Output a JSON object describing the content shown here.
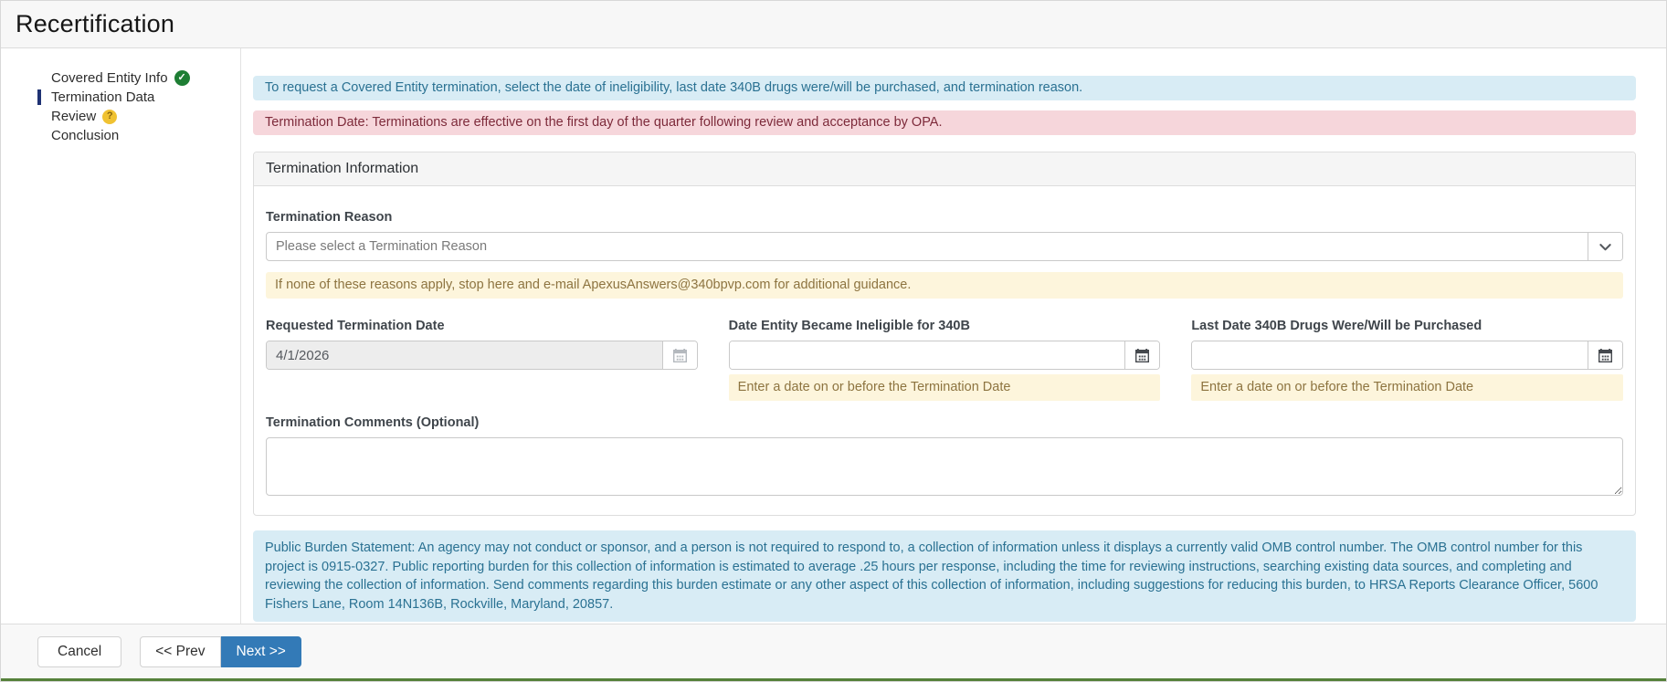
{
  "page": {
    "title": "Recertification"
  },
  "sidebar": {
    "items": [
      {
        "label": "Covered Entity Info",
        "status_icon": "check-circle",
        "active": false
      },
      {
        "label": "Termination Data",
        "status_icon": null,
        "active": true
      },
      {
        "label": "Review",
        "status_icon": "question-circle",
        "active": false
      },
      {
        "label": "Conclusion",
        "status_icon": null,
        "active": false
      }
    ]
  },
  "icons": {
    "check": "✓",
    "question": "?"
  },
  "alerts": {
    "info": "To request a Covered Entity termination, select the date of ineligibility, last date 340B drugs were/will be purchased, and termination reason.",
    "danger": "Termination Date: Terminations are effective on the first day of the quarter following review and acceptance by OPA."
  },
  "panel": {
    "title": "Termination Information",
    "reason": {
      "label": "Termination Reason",
      "placeholder": "Please select a Termination Reason"
    },
    "reason_note": "If none of these reasons apply, stop here and e-mail ApexusAnswers@340bpvp.com for additional guidance.",
    "dates": [
      {
        "label": "Requested Termination Date",
        "value": "4/1/2026",
        "disabled": true,
        "note": ""
      },
      {
        "label": "Date Entity Became Ineligible for 340B",
        "value": "",
        "disabled": false,
        "note": "Enter a date on or before the Termination Date"
      },
      {
        "label": "Last Date 340B Drugs Were/Will be Purchased",
        "value": "",
        "disabled": false,
        "note": "Enter a date on or before the Termination Date"
      }
    ],
    "comments": {
      "label": "Termination Comments (Optional)",
      "value": ""
    }
  },
  "burden_statement": "Public Burden Statement: An agency may not conduct or sponsor, and a person is not required to respond to, a collection of information unless it displays a currently valid OMB control number. The OMB control number for this project is 0915-0327. Public reporting burden for this collection of information is estimated to average .25 hours per response, including the time for reviewing instructions, searching existing data sources, and completing and reviewing the collection of information. Send comments regarding this burden estimate or any other aspect of this collection of information, including suggestions for reducing this burden, to HRSA Reports Clearance Officer, 5600 Fishers Lane, Room 14N136B, Rockville, Maryland, 20857.",
  "footer": {
    "cancel_label": "Cancel",
    "prev_label": "<< Prev",
    "next_label": "Next >>"
  },
  "colors": {
    "accent_blue": "#337ab7",
    "active_step_bar": "#1f3273",
    "success_green": "#1e7e34",
    "warning_yellow": "#f0c232",
    "info_bg": "#d8ecf5",
    "info_text": "#2a7192",
    "danger_bg": "#f6d6db",
    "danger_text": "#7d2a3a",
    "note_bg": "#fdf5dc",
    "note_text": "#8d7440",
    "footer_strip_green": "#55813a"
  }
}
